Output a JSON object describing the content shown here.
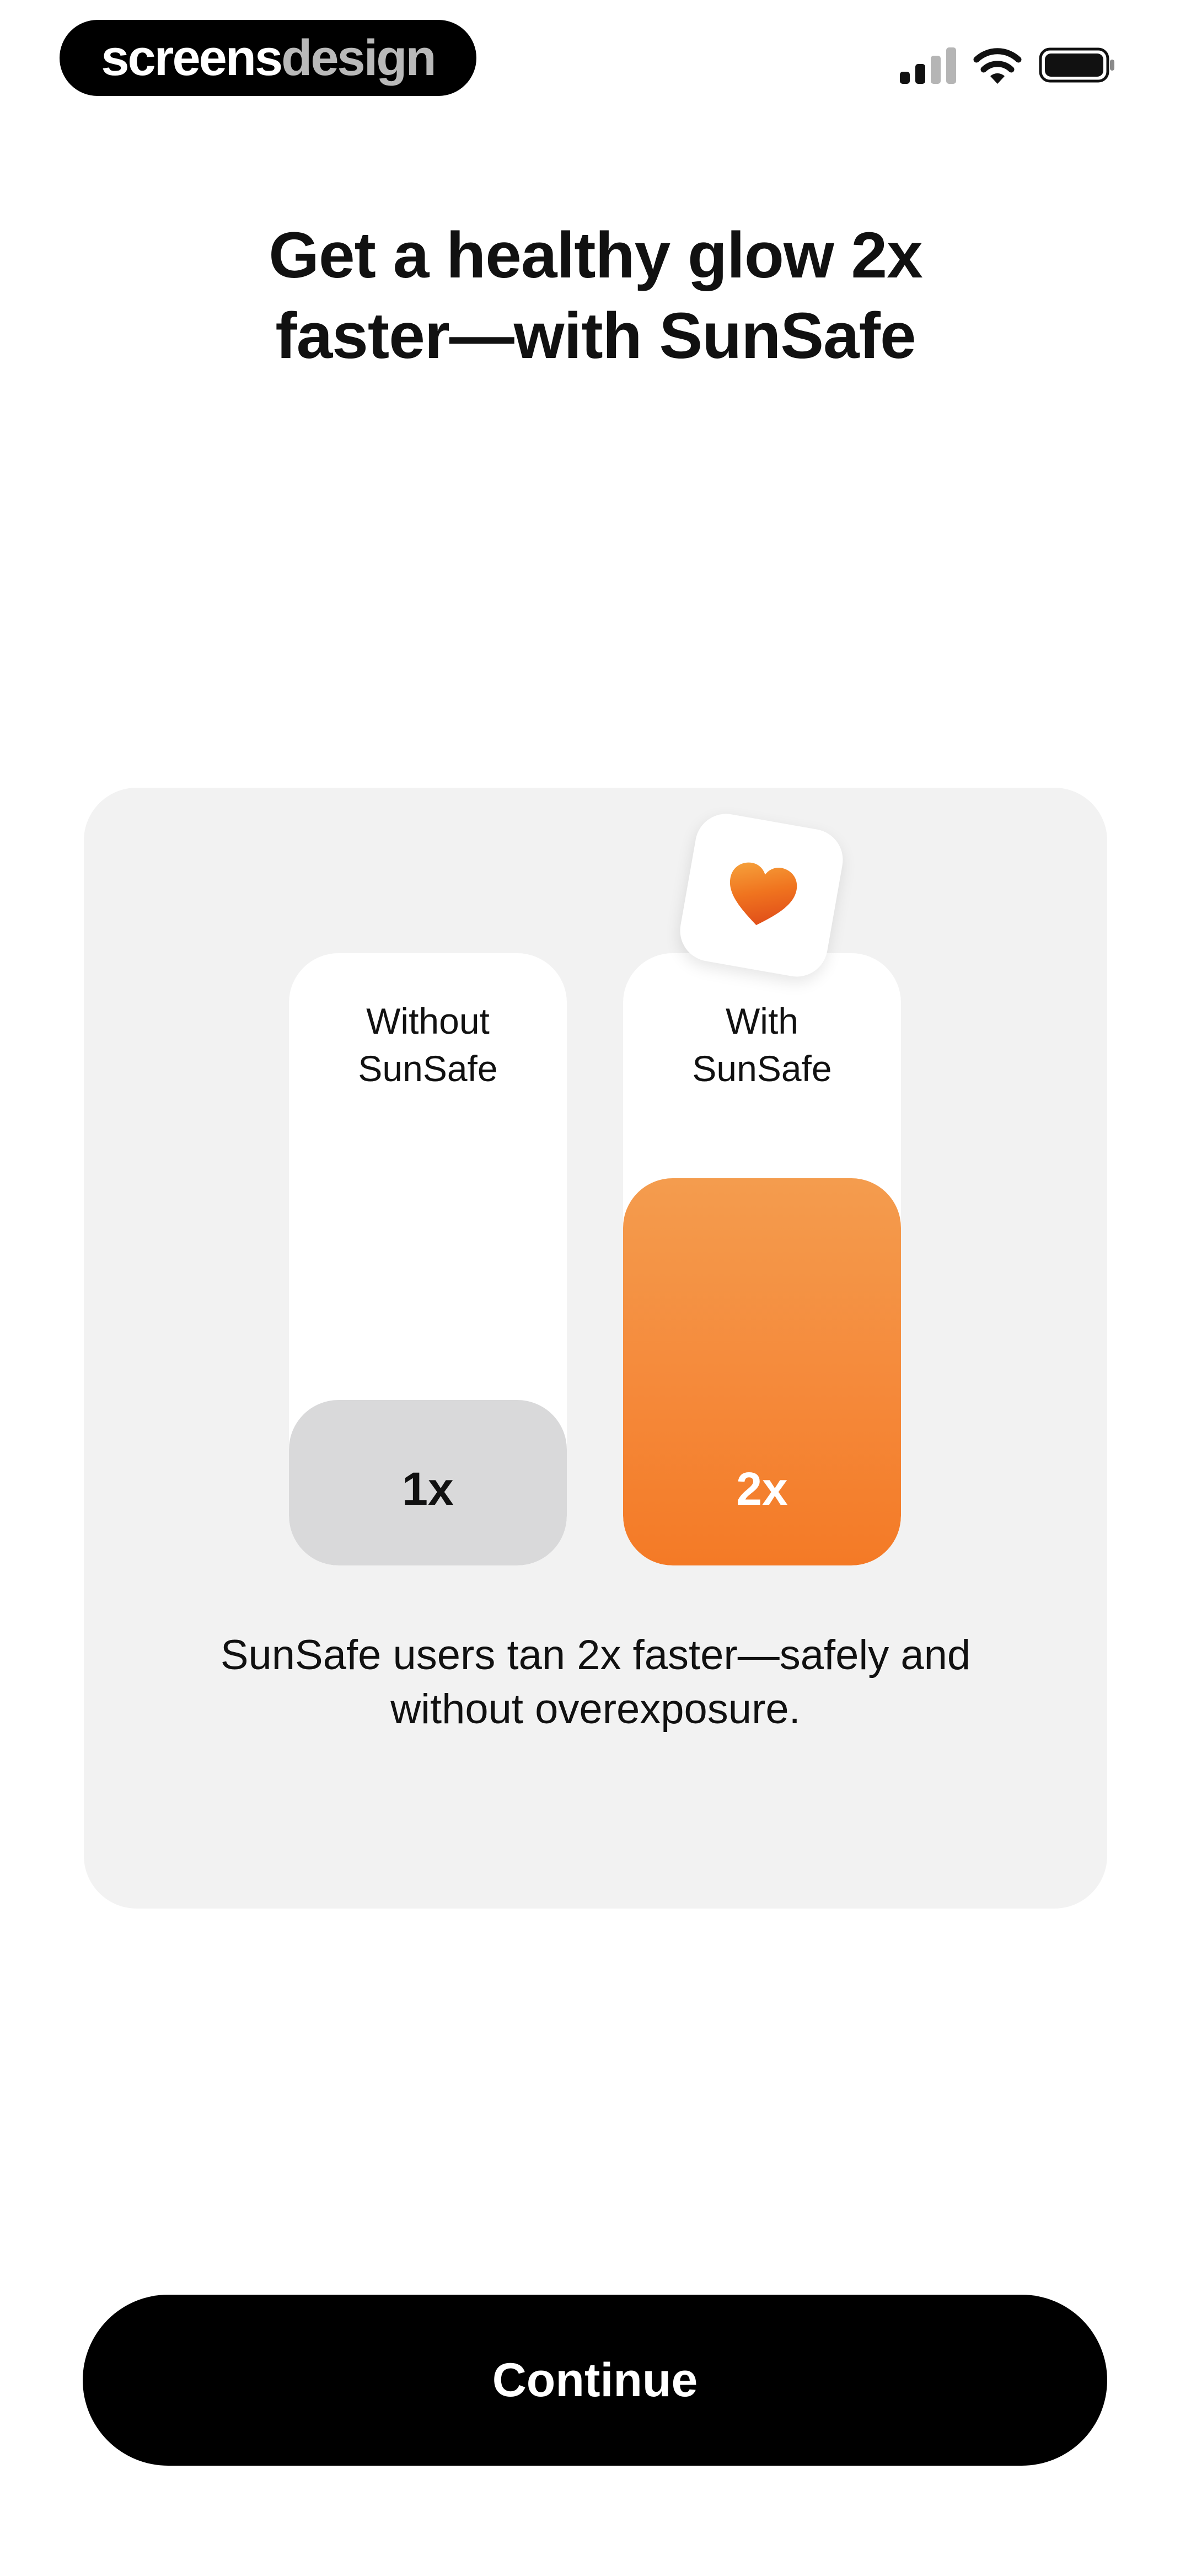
{
  "status_bar": {
    "brand_part1": "screens",
    "brand_part2": "design",
    "icons": [
      "signal-icon",
      "wifi-icon",
      "battery-icon"
    ]
  },
  "header": {
    "title_line1": "Get a healthy glow 2x",
    "title_line2": "faster—with SunSafe"
  },
  "comparison": {
    "badge_icon": "heart-icon",
    "without": {
      "label_line1": "Without",
      "label_line2": "SunSafe",
      "value_label": "1x",
      "multiplier": 1
    },
    "with": {
      "label_line1": "With",
      "label_line2": "SunSafe",
      "value_label": "2x",
      "multiplier": 2
    },
    "caption_line1": "SunSafe users tan 2x faster—safely and",
    "caption_line2": "without overexposure."
  },
  "footer": {
    "continue_label": "Continue"
  },
  "colors": {
    "accent_orange": "#f5893a",
    "bar_gray": "#d9d9da",
    "card_background": "#f2f2f2",
    "button_background": "#000000"
  }
}
